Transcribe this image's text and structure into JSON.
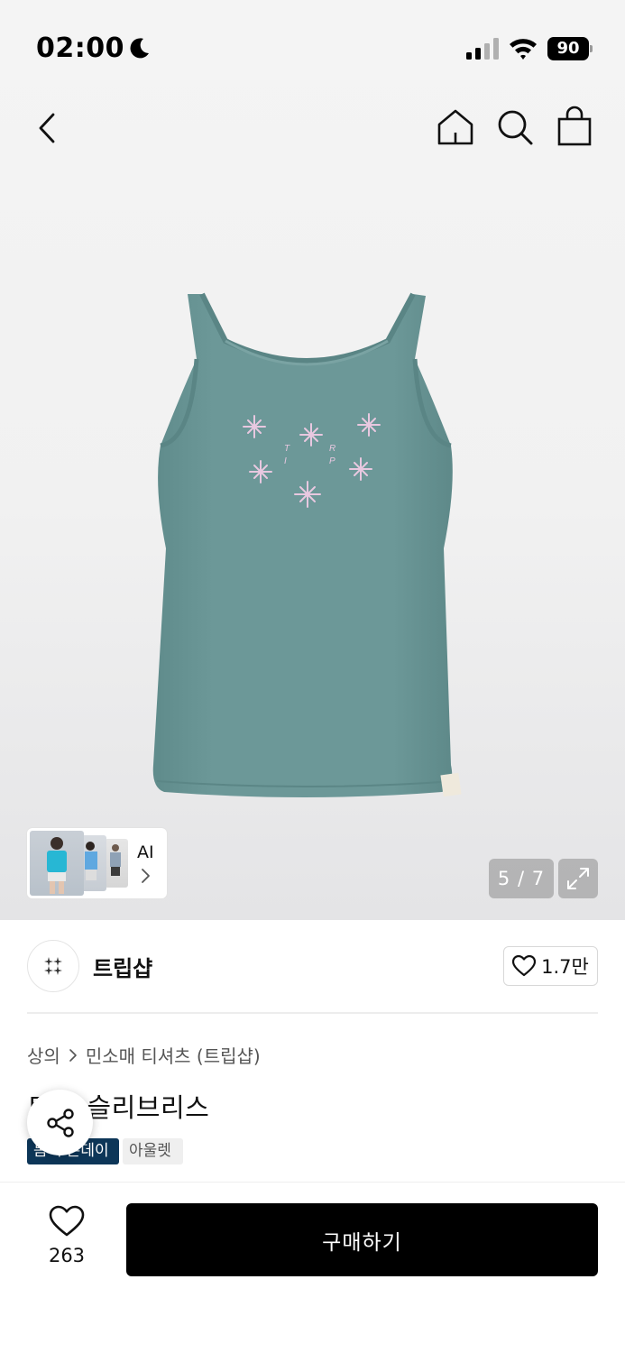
{
  "status_bar": {
    "time": "02:00",
    "battery": "90"
  },
  "nav": {
    "back_icon": "chevron-left-icon",
    "home_icon": "home-icon",
    "search_icon": "search-icon",
    "cart_icon": "shopping-bag-icon"
  },
  "gallery": {
    "ai_label": "AI",
    "counter": "5 / 7",
    "product_color": "#6e9a9a",
    "embroidery_letters": [
      "T",
      "I",
      "R",
      "P"
    ]
  },
  "brand": {
    "name": "트립샵",
    "like_count": "1.7만"
  },
  "breadcrumb": {
    "category": "상의",
    "subcategory": "민소매 티셔츠 (트립샵)"
  },
  "product": {
    "title": "트… 슬리브리스",
    "tags": [
      "봄 쿠폰데이",
      "아울렛"
    ]
  },
  "bottom_bar": {
    "like_count": "263",
    "buy_label": "구매하기"
  },
  "colors": {
    "buy_button": "#000000",
    "tag_dark": "#0d3658",
    "tag_light": "#efefef"
  }
}
